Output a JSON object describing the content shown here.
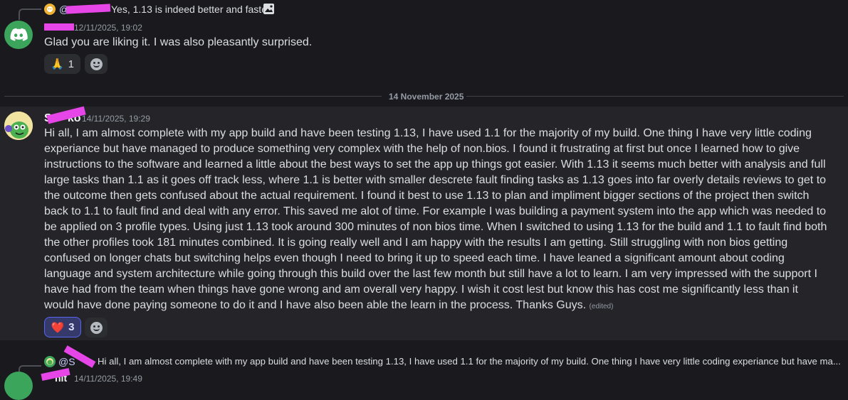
{
  "message1": {
    "reply": {
      "mention": "@",
      "text": "Yes, 1.13 is indeed better and faster."
    },
    "timestamp": "12/11/2025, 19:02",
    "content": "Glad you are liking it. I was also pleasantly surprised.",
    "reactions": [
      {
        "emoji": "🙏",
        "count": "1"
      }
    ]
  },
  "date_divider": "14 November 2025",
  "message2": {
    "author_partial": "S",
    "author_tail": "ko",
    "timestamp": "14/11/2025, 19:29",
    "content": "Hi all, I am almost complete with my app build and have been testing 1.13, I have used 1.1 for the majority of my build. One thing I have very little coding experiance but have managed to produce something very complex with the help of non.bios. I found it frustrating at first but once I learned how to give instructions to the software and learned a little about the best ways to set the app up things got easier. With 1.13 it seems much better with analysis and full large tasks than 1.1 as it goes off track less, where 1.1 is better with smaller descrete fault finding tasks as 1.13 goes into far overly details reviews to get to the outcome then gets confused about the actual requirement. I found it best to use 1.13 to plan and impliment bigger sections of the project then switch back to 1.1 to fault find and deal with any error. This saved me alot of time. For example I was building a payment system into the app which was needed to be applied on 3 profile types. Using just 1.13 took around 300 minutes of non bios time. When I switched to using 1.13 for the build and 1.1 to fault find both the other profiles took 181 minutes combined. It is going really well and I am happy with the results I am getting. Still struggling with non bios getting confused on longer chats but switching helps even though I need to bring it up to speed each time. I have leaned a significant amount about coding language and system architecture while going through this build over the last few month but still have a lot to learn. I am very impressed with the support I have had from the team when things have gone wrong and am overall very happy. I wish it cost lest but know this has cost me significantly less than it would have done paying someone to do it and I have also been able the learn in the process. Thanks Guys.",
    "edited": "(edited)",
    "reactions": [
      {
        "emoji": "❤️",
        "count": "3"
      }
    ]
  },
  "message3": {
    "reply": {
      "mention": "@S",
      "text": "Hi all, I am almost complete with my app build and have been testing 1.13, I have used 1.1 for the majority of my build. One thing I have very little coding experiance but have ma..."
    },
    "author_partial": "nit",
    "timestamp": "14/11/2025, 19:49"
  },
  "colors": {
    "discord_blurple": "#5865f2",
    "bot_avatar_green": "#3ba55c",
    "redaction": "#e646e8"
  },
  "icons": [
    "discord-logo-icon",
    "image-icon",
    "add-reaction-icon",
    "sad-face-icon"
  ]
}
